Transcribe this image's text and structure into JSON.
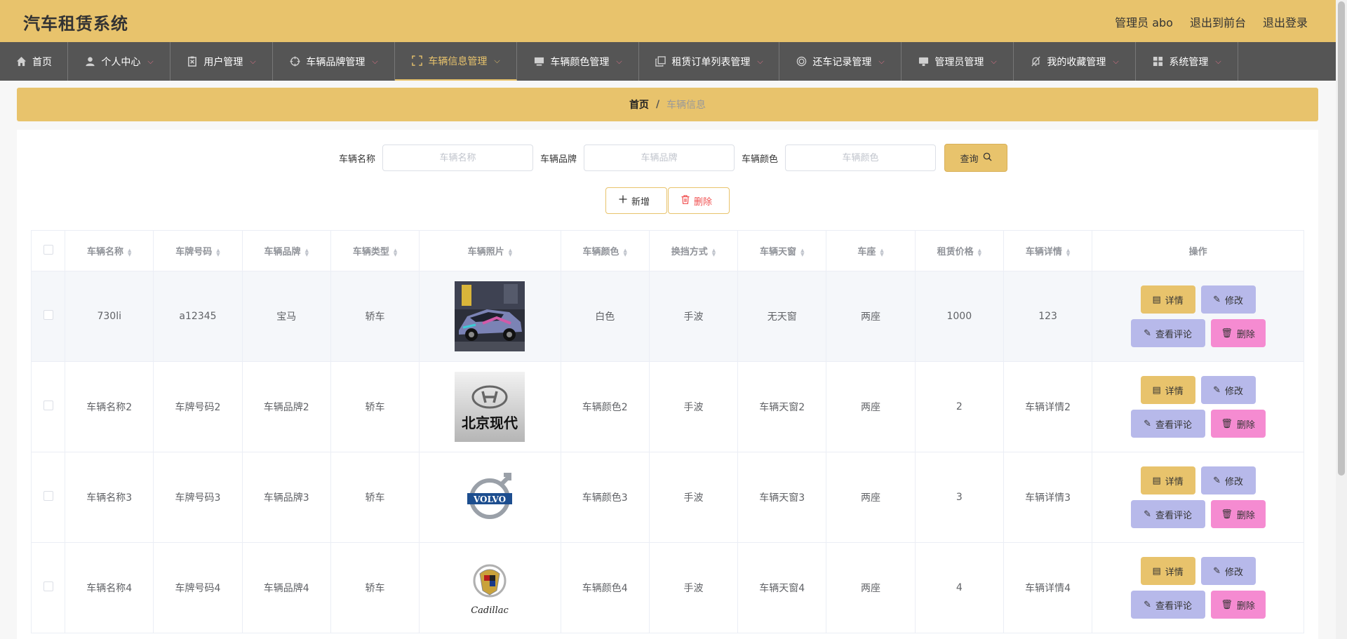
{
  "header": {
    "title": "汽车租赁系统",
    "admin_label": "管理员 abo",
    "back_to_front": "退出到前台",
    "logout": "退出登录"
  },
  "nav": [
    {
      "label": "首页",
      "icon": "home-icon",
      "has_dropdown": false
    },
    {
      "label": "个人中心",
      "icon": "user-icon",
      "has_dropdown": true
    },
    {
      "label": "用户管理",
      "icon": "clipboard-icon",
      "has_dropdown": true
    },
    {
      "label": "车辆品牌管理",
      "icon": "target-icon",
      "has_dropdown": true
    },
    {
      "label": "车辆信息管理",
      "icon": "frame-icon",
      "has_dropdown": true,
      "active": true
    },
    {
      "label": "车辆颜色管理",
      "icon": "monitor-icon",
      "has_dropdown": true
    },
    {
      "label": "租赁订单列表管理",
      "icon": "copy-icon",
      "has_dropdown": true
    },
    {
      "label": "还车记录管理",
      "icon": "ring-icon",
      "has_dropdown": true
    },
    {
      "label": "管理员管理",
      "icon": "screen-icon",
      "has_dropdown": true
    },
    {
      "label": "我的收藏管理",
      "icon": "bell-off-icon",
      "has_dropdown": true
    },
    {
      "label": "系统管理",
      "icon": "grid-icon",
      "has_dropdown": true
    }
  ],
  "breadcrumb": {
    "home": "首页",
    "separator": "/",
    "current": "车辆信息"
  },
  "search": {
    "name_label": "车辆名称",
    "name_placeholder": "车辆名称",
    "brand_label": "车辆品牌",
    "brand_placeholder": "车辆品牌",
    "color_label": "车辆颜色",
    "color_placeholder": "车辆颜色",
    "query_button": "查询"
  },
  "actions": {
    "add": "新增",
    "delete": "删除"
  },
  "table": {
    "columns": [
      "车辆名称",
      "车牌号码",
      "车辆品牌",
      "车辆类型",
      "车辆照片",
      "车辆颜色",
      "换挡方式",
      "车辆天窗",
      "车座",
      "租赁价格",
      "车辆详情",
      "操作"
    ],
    "rows": [
      {
        "name": "730li",
        "plate": "a12345",
        "brand": "宝马",
        "type": "轿车",
        "photo": "race-car-photo",
        "color": "白色",
        "gear": "手波",
        "sunroof": "无天窗",
        "seats": "两座",
        "price": "1000",
        "detail": "123"
      },
      {
        "name": "车辆名称2",
        "plate": "车牌号码2",
        "brand": "车辆品牌2",
        "type": "轿车",
        "photo": "hyundai-logo",
        "photo_text": "北京现代",
        "color": "车辆颜色2",
        "gear": "手波",
        "sunroof": "车辆天窗2",
        "seats": "两座",
        "price": "2",
        "detail": "车辆详情2"
      },
      {
        "name": "车辆名称3",
        "plate": "车牌号码3",
        "brand": "车辆品牌3",
        "type": "轿车",
        "photo": "volvo-logo",
        "photo_text": "VOLVO",
        "color": "车辆颜色3",
        "gear": "手波",
        "sunroof": "车辆天窗3",
        "seats": "两座",
        "price": "3",
        "detail": "车辆详情3"
      },
      {
        "name": "车辆名称4",
        "plate": "车牌号码4",
        "brand": "车辆品牌4",
        "type": "轿车",
        "photo": "cadillac-logo",
        "photo_text": "Cadillac",
        "color": "车辆颜色4",
        "gear": "手波",
        "sunroof": "车辆天窗4",
        "seats": "两座",
        "price": "4",
        "detail": "车辆详情4"
      }
    ],
    "ops": {
      "detail": "详情",
      "edit": "修改",
      "comment": "查看评论",
      "delete": "删除"
    }
  },
  "colors": {
    "accent": "#e8c36c",
    "nav_bg": "#555555",
    "edit_btn": "#b7b9ea",
    "delete_btn": "#f58bd1",
    "danger_text": "#f05050"
  }
}
